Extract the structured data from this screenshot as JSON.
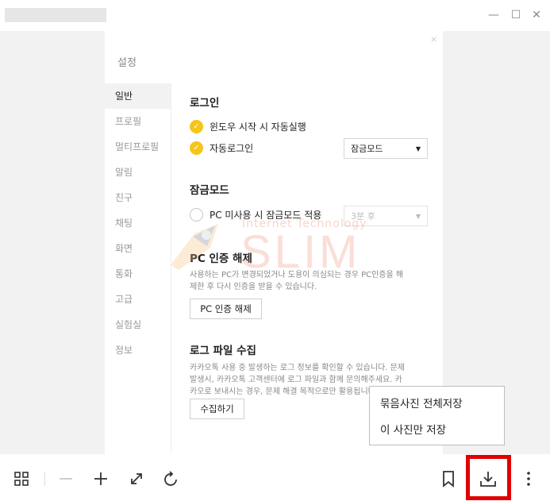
{
  "window": {
    "minimize_glyph": "—",
    "maximize_glyph": "☐",
    "close_glyph": "✕"
  },
  "settings": {
    "close_glyph": "×",
    "title": "설정",
    "sidebar": [
      {
        "label": "일반",
        "active": true
      },
      {
        "label": "프로필"
      },
      {
        "label": "멀티프로필"
      },
      {
        "label": "알림"
      },
      {
        "label": "친구"
      },
      {
        "label": "채팅"
      },
      {
        "label": "화면"
      },
      {
        "label": "통화"
      },
      {
        "label": "고급"
      },
      {
        "label": "실험실"
      },
      {
        "label": "정보"
      }
    ],
    "login": {
      "title": "로그인",
      "option1": "윈도우 시작 시 자동실행",
      "option2": "자동로그인",
      "option2_select": "잠금모드"
    },
    "lock": {
      "title": "잠금모드",
      "option": "PC 미사용 시 잠금모드 적용",
      "select": "3분 후"
    },
    "pc_auth": {
      "title": "PC 인증 해제",
      "desc1": "사용하는 PC가 변경되었거나 도용이 의심되는 경우 PC인증을 해",
      "desc2": "제한 후 다시 인증을 받을 수 있습니다.",
      "button": "PC 인증 해제"
    },
    "log": {
      "title": "로그 파일 수집",
      "desc1": "카카오톡 사용 중 발생하는 로그 정보를 확인할 수 있습니다. 문제",
      "desc2": "발생시, 카카오톡 고객센터에 로그 파일과 함께 문의해주세요. 카",
      "desc3": "카오로 보내시는 경우, 문제 해결 목적으로만 활용됩니다.",
      "button": "수집하기"
    }
  },
  "watermark": {
    "sub": "Internet Technology",
    "main": "SLIM"
  },
  "popup": {
    "item1": "묶음사진 전체저장",
    "item2": "이 사진만 저장"
  },
  "toolbar": {
    "icons": [
      "grid-icon",
      "zoom-out-icon",
      "zoom-in-icon",
      "expand-icon",
      "rotate-icon",
      "bookmark-icon",
      "download-icon",
      "more-icon"
    ]
  },
  "colors": {
    "check": "#f5c518",
    "highlight": "#e00000",
    "watermark": "#f0a08c"
  }
}
